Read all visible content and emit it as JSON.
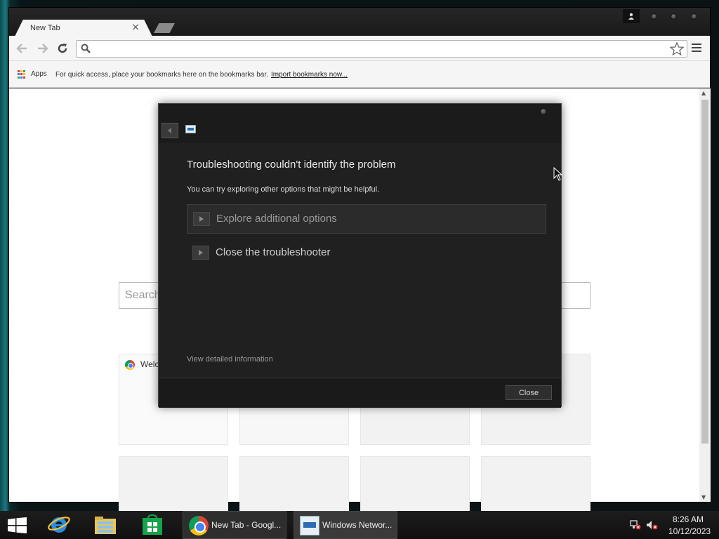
{
  "browser": {
    "tab_title": "New Tab",
    "tab_close": "×",
    "omnibox_value": "",
    "bookmarks_bar": {
      "apps_label": "Apps",
      "hint": "For quick access, place your bookmarks here on the bookmarks bar.",
      "import_link": "Import bookmarks now..."
    },
    "ntp": {
      "search_placeholder": "Search",
      "tile_1_title": "Welc"
    }
  },
  "dialog": {
    "title": "Troubleshooting couldn't identify the problem",
    "subtitle": "You can try exploring other options that might be helpful.",
    "options": [
      {
        "label": "Explore additional options"
      },
      {
        "label": "Close the troubleshooter"
      }
    ],
    "details_link": "View detailed information",
    "close_button": "Close"
  },
  "taskbar": {
    "tasks": [
      {
        "label": "New Tab - Googl..."
      },
      {
        "label": "Windows Networ..."
      }
    ],
    "clock": {
      "time": "8:26 AM",
      "date": "10/12/2023"
    }
  },
  "colors": {
    "dialog_bg": "#202020",
    "dialog_text": "#e8e8e8",
    "taskbar_bg": "#151515"
  }
}
